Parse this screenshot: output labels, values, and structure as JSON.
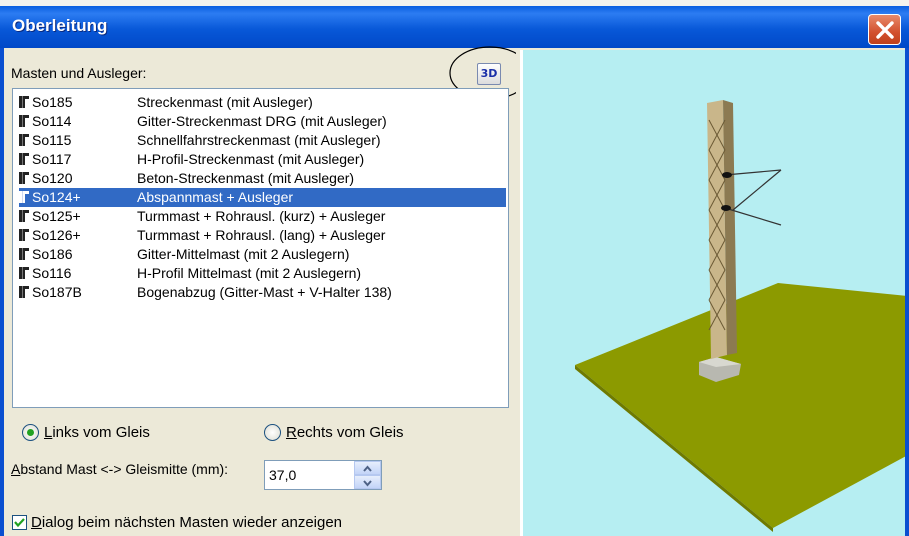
{
  "window": {
    "title": "Oberleitung",
    "close_icon": "close-icon"
  },
  "masts_label": "Masten und Ausleger:",
  "btn_3d_label": "3D",
  "list_items": [
    {
      "code": "So185",
      "desc": "Streckenmast (mit Ausleger)",
      "selected": false
    },
    {
      "code": "So114",
      "desc": "Gitter-Streckenmast DRG (mit Ausleger)",
      "selected": false
    },
    {
      "code": "So115",
      "desc": "Schnellfahrstreckenmast (mit Ausleger)",
      "selected": false
    },
    {
      "code": "So117",
      "desc": "H-Profil-Streckenmast (mit Ausleger)",
      "selected": false
    },
    {
      "code": "So120",
      "desc": "Beton-Streckenmast (mit Ausleger)",
      "selected": false
    },
    {
      "code": "So124+",
      "desc": "Abspannmast + Ausleger",
      "selected": true
    },
    {
      "code": "So125+",
      "desc": "Turmmast + Rohrausl. (kurz) + Ausleger",
      "selected": false
    },
    {
      "code": "So126+",
      "desc": "Turmmast + Rohrausl. (lang) + Ausleger",
      "selected": false
    },
    {
      "code": "So186",
      "desc": "Gitter-Mittelmast (mit 2 Auslegern)",
      "selected": false
    },
    {
      "code": "So116",
      "desc": "H-Profil Mittelmast (mit 2 Auslegern)",
      "selected": false
    },
    {
      "code": "So187B",
      "desc": "Bogenabzug (Gitter-Mast + V-Halter 138)",
      "selected": false
    }
  ],
  "radio_left": {
    "label_first": "L",
    "label_rest": "inks vom Gleis",
    "checked": true
  },
  "radio_right": {
    "label_first": "R",
    "label_rest": "echts vom Gleis",
    "checked": false
  },
  "abstand": {
    "label_first": "A",
    "label_rest": "bstand Mast <-> Gleismitte (mm):",
    "value": "37,0"
  },
  "checkbox": {
    "label_first": "D",
    "label_rest": "ialog beim nächsten Masten wieder anzeigen",
    "checked": true
  },
  "colors": {
    "titlebar": "#0a5ee0",
    "selection": "#316ac5",
    "viewport_bg": "#b6eef2",
    "ground": "#8c9a00"
  }
}
